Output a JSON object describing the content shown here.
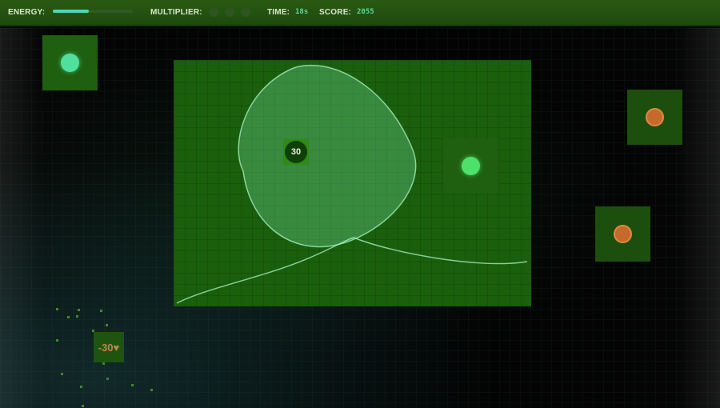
{
  "hud": {
    "energy_label": "ENERGY:",
    "energy_level": 0.45,
    "multiplier_label": "MULTIPLIER:",
    "multiplier_slots": 3,
    "multiplier_active": 0,
    "time_label": "TIME:",
    "time_value": "18s",
    "score_label": "SCORE:",
    "score_value": "2055"
  },
  "field": {
    "bonus_value": "30",
    "penalty_value": "-30♥",
    "orbs": [
      {
        "kind": "green",
        "color": "#4fe0a0"
      },
      {
        "kind": "lime",
        "color": "#4de06a"
      },
      {
        "kind": "orange",
        "color": "#c56a2c"
      },
      {
        "kind": "orange",
        "color": "#c56a2c"
      }
    ]
  },
  "colors": {
    "hud_bg": "#2a5a12",
    "arena_bg": "#1a5f0c",
    "energy_fill": "#4fd6b4",
    "value_text": "#5fd3a0"
  }
}
